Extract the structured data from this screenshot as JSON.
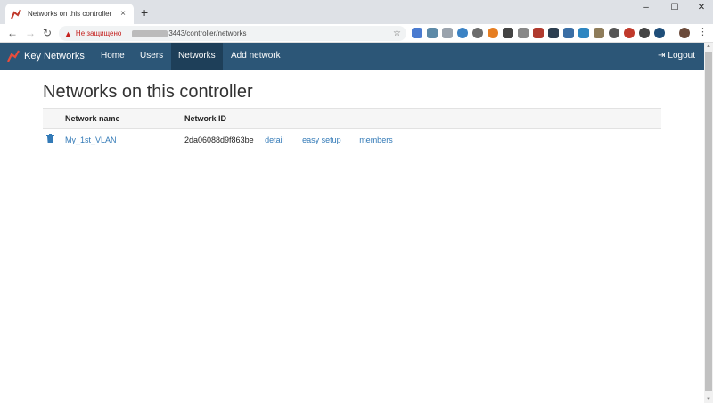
{
  "browser": {
    "tab_title": "Networks on this controller",
    "tab_close": "×",
    "new_tab": "+",
    "window_controls": {
      "minimize": "–",
      "maximize": "☐",
      "close": "✕"
    },
    "nav": {
      "back": "←",
      "forward": "→",
      "reload": "↻"
    },
    "omnibox": {
      "warning_icon": "▲",
      "security_label": "Не защищено",
      "url": "3443/controller/networks",
      "bookmark_icon": "☆"
    },
    "menu": "⋮"
  },
  "navbar": {
    "brand": "Key Networks",
    "items": [
      {
        "label": "Home",
        "active": false
      },
      {
        "label": "Users",
        "active": false
      },
      {
        "label": "Networks",
        "active": true
      },
      {
        "label": "Add network",
        "active": false
      }
    ],
    "logout_icon": "⇥",
    "logout": "Logout"
  },
  "page": {
    "title": "Networks on this controller",
    "table": {
      "headers": {
        "name": "Network name",
        "id": "Network ID"
      },
      "rows": [
        {
          "name": "My_1st_VLAN",
          "id": "2da06088d9f863be",
          "actions": {
            "detail": "detail",
            "easy_setup": "easy setup",
            "members": "members"
          }
        }
      ]
    }
  },
  "colors": {
    "navbar_bg": "#2c5677",
    "navbar_active": "#1e3f59",
    "link": "#337ab7",
    "insecure": "#c5221f"
  }
}
